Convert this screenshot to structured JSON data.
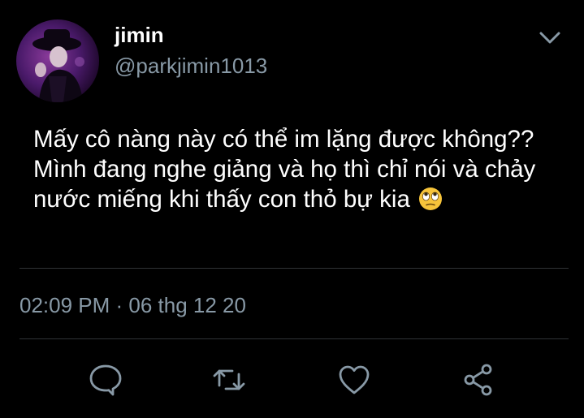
{
  "tweet": {
    "display_name": "jimin",
    "handle": "@parkjimin1013",
    "text": "Mấy cô nàng này có thể im lặng được không?? Mình đang nghe giảng và họ thì chỉ nói và chảy nước miếng khi thấy con thỏ bự kia",
    "emoji": "face-with-rolling-eyes",
    "timestamp": "02:09 PM · 06 thg 12 20"
  },
  "icons": {
    "avatar": "profile-photo",
    "menu": "chevron-down-icon",
    "reply": "speech-bubble-icon",
    "retweet": "retweet-arrows-icon",
    "like": "heart-icon",
    "share": "share-nodes-icon"
  },
  "colors": {
    "background": "#000000",
    "text": "#ffffff",
    "secondary": "#8899a6",
    "divider": "#2f3336",
    "emoji_face": "#f7c43a"
  }
}
